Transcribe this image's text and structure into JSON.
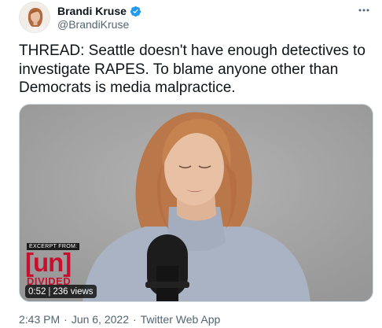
{
  "user": {
    "display_name": "Brandi Kruse",
    "handle": "@BrandiKruse",
    "verified": true
  },
  "tweet": {
    "text": "THREAD: Seattle doesn't have enough detectives to investigate RAPES. To blame anyone other than Democrats is media malpractice."
  },
  "media": {
    "overlay_tag": "EXCERPT FROM:",
    "brand": "[un]",
    "brand_sub": "DIVIDED",
    "duration": "0:52",
    "views": "236 views"
  },
  "meta": {
    "time": "2:43 PM",
    "date": "Jun 6, 2022",
    "source": "Twitter Web App",
    "separator": "·"
  },
  "colors": {
    "verified_blue": "#1d9bf0",
    "brand_red": "#c8102e",
    "secondary_text": "#536471"
  },
  "icons": {
    "verified": "verified-badge-icon",
    "more": "more-options-icon"
  }
}
